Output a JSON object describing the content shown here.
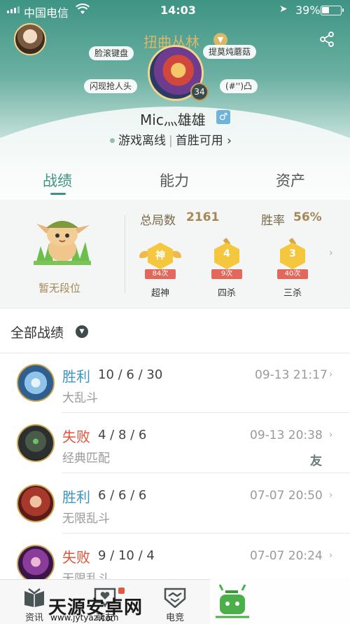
{
  "status_bar": {
    "carrier": "中国电信",
    "time": "14:03",
    "battery_pct": "39%",
    "battery_level": 0.39
  },
  "header": {
    "nickname": "扭曲丛林",
    "player_name": "Mic灬雄雄",
    "level": "34",
    "tags": [
      "脸滚键盘",
      "提莫炖蘑菇",
      "闪现抢人头",
      "(#'')凸"
    ],
    "status_text": "游戏离线",
    "first_win_text": "首胜可用"
  },
  "tabs": [
    "战绩",
    "能力",
    "资产"
  ],
  "stats": {
    "rank_label": "暂无段位",
    "total_games_label": "总局数",
    "total_games_value": "2161",
    "win_rate_label": "胜率",
    "win_rate_value": "56%",
    "medals": [
      {
        "badge": "神",
        "count": "84次",
        "name": "超神"
      },
      {
        "badge": "4",
        "count": "9次",
        "name": "四杀"
      },
      {
        "badge": "3",
        "count": "40次",
        "name": "三杀"
      }
    ]
  },
  "section_title": "全部战绩",
  "matches": [
    {
      "result": "胜利",
      "kda": "10 / 6 / 30",
      "mode": "大乱斗",
      "time": "09-13 21:17",
      "friend": ""
    },
    {
      "result": "失败",
      "kda": "4 / 8 / 6",
      "mode": "经典匹配",
      "time": "09-13 20:38",
      "friend": "友"
    },
    {
      "result": "胜利",
      "kda": "6 / 6 / 6",
      "mode": "无限乱斗",
      "time": "07-07 20:50",
      "friend": ""
    },
    {
      "result": "失败",
      "kda": "9 / 10 / 4",
      "mode": "无限乱斗",
      "time": "07-07 20:24",
      "friend": ""
    }
  ],
  "bottom_nav": [
    "资讯",
    "萌友",
    "电竞"
  ],
  "watermark": {
    "title": "天源安卓网",
    "url": "www.jytyaz.com"
  },
  "colors": {
    "accent": "#3e9484",
    "win": "#3c96c0",
    "lose": "#e0523a",
    "gold": "#a58856"
  }
}
